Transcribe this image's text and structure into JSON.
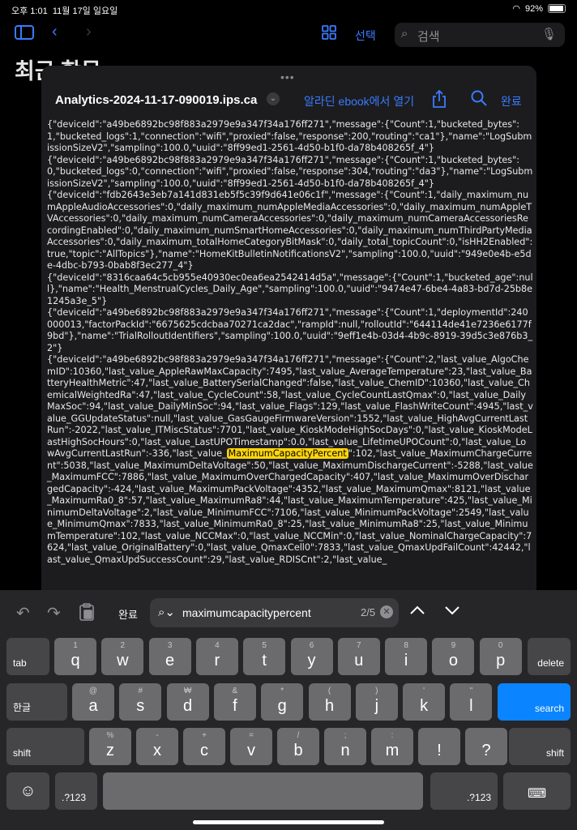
{
  "status": {
    "time": "오후 1:01",
    "date": "11월 17일 일요일",
    "battery": "92%",
    "wifi_icon": "wifi-icon"
  },
  "bg": {
    "select_label": "선택",
    "search_placeholder": "검색",
    "title": "최근 항목"
  },
  "sheet": {
    "file_name": "Analytics-2024-11-17-090019.ips.ca",
    "open_label": "알라딘 ebook에서 열기",
    "done_label": "완료",
    "log": [
      "{\"deviceId\":\"a49be6892bc98f883a2979e9a347f34a176ff271\",\"message\":{\"Count\":1,\"bucketed_bytes\":1,\"bucketed_logs\":1,\"connection\":\"wifi\",\"proxied\":false,\"response\":200,\"routing\":\"ca1\"},\"name\":\"LogSubmissionSizeV2\",\"sampling\":100.0,\"uuid\":\"8ff99ed1-2561-4d50-b1f0-da78b408265f_4\"}",
      "{\"deviceId\":\"a49be6892bc98f883a2979e9a347f34a176ff271\",\"message\":{\"Count\":1,\"bucketed_bytes\":0,\"bucketed_logs\":0,\"connection\":\"wifi\",\"proxied\":false,\"response\":304,\"routing\":\"da3\"},\"name\":\"LogSubmissionSizeV2\",\"sampling\":100.0,\"uuid\":\"8ff99ed1-2561-4d50-b1f0-da78b408265f_4\"}",
      "{\"deviceId\":\"fdb2643e3eb7a141d831eb5f5c39f9d641e06c1f\",\"message\":{\"Count\":1,\"daily_maximum_numAppleAudioAccessories\":0,\"daily_maximum_numAppleMediaAccessories\":0,\"daily_maximum_numAppleTVAccessories\":0,\"daily_maximum_numCameraAccessories\":0,\"daily_maximum_numCameraAccessoriesRecordingEnabled\":0,\"daily_maximum_numSmartHomeAccessories\":0,\"daily_maximum_numThirdPartyMediaAccessories\":0,\"daily_maximum_totalHomeCategoryBitMask\":0,\"daily_total_topicCount\":0,\"isHH2Enabled\":true,\"topic\":\"AllTopics\"},\"name\":\"HomeKitBulletinNotificationsV2\",\"sampling\":100.0,\"uuid\":\"949e0e4b-e5de-4dbc-b793-0bab8f3ec277_4\"}",
      "{\"deviceId\":\"8316caa64c5cb955e40930ec0ea6ea2542414d5a\",\"message\":{\"Count\":1,\"bucketed_age\":null},\"name\":\"Health_MenstrualCycles_Daily_Age\",\"sampling\":100.0,\"uuid\":\"9474e47-6be4-4a83-bd7d-25b8e1245a3e_5\"}",
      "{\"deviceId\":\"a49be6892bc98f883a2979e9a347f34a176ff271\",\"message\":{\"Count\":1,\"deploymentId\":240000013,\"factorPackId\":\"6675625cdcbaa70271ca2dac\",\"rampId\":null,\"rolloutId\":\"644114de41e7236e6177f9bd\"},\"name\":\"TrialRolloutIdentifiers\",\"sampling\":100.0,\"uuid\":\"9eff1e4b-03d4-4b9c-8919-39d5c3e876b3_2\"}"
    ],
    "log_last_before": "{\"deviceId\":\"a49be6892bc98f883a2979e9a347f34a176ff271\",\"message\":{\"Count\":2,\"last_value_AlgoChemID\":10360,\"last_value_AppleRawMaxCapacity\":7495,\"last_value_AverageTemperature\":23,\"last_value_BatteryHealthMetric\":47,\"last_value_BatterySerialChanged\":false,\"last_value_ChemID\":10360,\"last_value_ChemicalWeightedRa\":47,\"last_value_CycleCount\":58,\"last_value_CycleCountLastQmax\":0,\"last_value_DailyMaxSoc\":94,\"last_value_DailyMinSoc\":94,\"last_value_Flags\":129,\"last_value_FlashWriteCount\":4945,\"last_value_GGUpdateStatus\":null,\"last_value_GasGaugeFirmwareVersion\":1552,\"last_value_HighAvgCurrentLastRun\":-2022,\"last_value_ITMiscStatus\":7701,\"last_value_KioskModeHighSocDays\":0,\"last_value_KioskModeLastHighSocHours\":0,\"last_value_LastUPOTimestamp\":0.0,\"last_value_LifetimeUPOCount\":0,\"last_value_LowAvgCurrentLastRun\":-336,\"last_value_",
    "log_highlight": "MaximumCapacityPercent",
    "log_last_after": "\":102,\"last_value_MaximumChargeCurrent\":5038,\"last_value_MaximumDeltaVoltage\":50,\"last_value_MaximumDischargeCurrent\":-5288,\"last_value_MaximumFCC\":7886,\"last_value_MaximumOverChargedCapacity\":407,\"last_value_MaximumOverDischargedCapacity\":-424,\"last_value_MaximumPackVoltage\":4352,\"last_value_MaximumQmax\":8121,\"last_value_MaximumRa0_8\":57,\"last_value_MaximumRa8\":44,\"last_value_MaximumTemperature\":425,\"last_value_MinimumDeltaVoltage\":2,\"last_value_MinimumFCC\":7106,\"last_value_MinimumPackVoltage\":2549,\"last_value_MinimumQmax\":7833,\"last_value_MinimumRa0_8\":25,\"last_value_MinimumRa8\":25,\"last_value_MinimumTemperature\":102,\"last_value_NCCMax\":0,\"last_value_NCCMin\":0,\"last_value_NominalChargeCapacity\":7624,\"last_value_OriginalBattery\":0,\"last_value_QmaxCell0\":7833,\"last_value_QmaxUpdFailCount\":42442,\"last_value_QmaxUpdSuccessCount\":29,\"last_value_RDISCnt\":2,\"last_value_"
  },
  "find": {
    "done_label": "완료",
    "query": "maximumcapacitypercent",
    "match_count": "2/5"
  },
  "keyboard": {
    "row1": [
      {
        "sub": "1",
        "main": "q"
      },
      {
        "sub": "2",
        "main": "w"
      },
      {
        "sub": "3",
        "main": "e"
      },
      {
        "sub": "4",
        "main": "r"
      },
      {
        "sub": "5",
        "main": "t"
      },
      {
        "sub": "6",
        "main": "y"
      },
      {
        "sub": "7",
        "main": "u"
      },
      {
        "sub": "8",
        "main": "i"
      },
      {
        "sub": "9",
        "main": "o"
      },
      {
        "sub": "0",
        "main": "p"
      }
    ],
    "row2": [
      {
        "sub": "@",
        "main": "a"
      },
      {
        "sub": "#",
        "main": "s"
      },
      {
        "sub": "₩",
        "main": "d"
      },
      {
        "sub": "&",
        "main": "f"
      },
      {
        "sub": "*",
        "main": "g"
      },
      {
        "sub": "(",
        "main": "h"
      },
      {
        "sub": ")",
        "main": "j"
      },
      {
        "sub": "'",
        "main": "k"
      },
      {
        "sub": "\"",
        "main": "l"
      }
    ],
    "row3": [
      {
        "sub": "%",
        "main": "z"
      },
      {
        "sub": "-",
        "main": "x"
      },
      {
        "sub": "+",
        "main": "c"
      },
      {
        "sub": "=",
        "main": "v"
      },
      {
        "sub": "/",
        "main": "b"
      },
      {
        "sub": ";",
        "main": "n"
      },
      {
        "sub": ":",
        "main": "m"
      },
      {
        "sub": "",
        "main": "!"
      },
      {
        "sub": "",
        "main": "?"
      }
    ],
    "tab": "tab",
    "delete": "delete",
    "lang": "한글",
    "search": "search",
    "shift": "shift",
    "numbers": ".?123"
  }
}
